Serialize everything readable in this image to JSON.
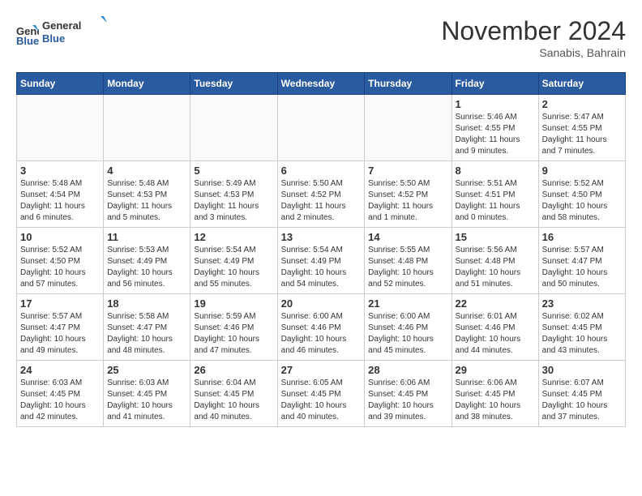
{
  "logo": {
    "line1": "General",
    "line2": "Blue"
  },
  "title": "November 2024",
  "location": "Sanabis, Bahrain",
  "weekdays": [
    "Sunday",
    "Monday",
    "Tuesday",
    "Wednesday",
    "Thursday",
    "Friday",
    "Saturday"
  ],
  "weeks": [
    [
      {
        "day": "",
        "info": ""
      },
      {
        "day": "",
        "info": ""
      },
      {
        "day": "",
        "info": ""
      },
      {
        "day": "",
        "info": ""
      },
      {
        "day": "",
        "info": ""
      },
      {
        "day": "1",
        "info": "Sunrise: 5:46 AM\nSunset: 4:55 PM\nDaylight: 11 hours and 9 minutes."
      },
      {
        "day": "2",
        "info": "Sunrise: 5:47 AM\nSunset: 4:55 PM\nDaylight: 11 hours and 7 minutes."
      }
    ],
    [
      {
        "day": "3",
        "info": "Sunrise: 5:48 AM\nSunset: 4:54 PM\nDaylight: 11 hours and 6 minutes."
      },
      {
        "day": "4",
        "info": "Sunrise: 5:48 AM\nSunset: 4:53 PM\nDaylight: 11 hours and 5 minutes."
      },
      {
        "day": "5",
        "info": "Sunrise: 5:49 AM\nSunset: 4:53 PM\nDaylight: 11 hours and 3 minutes."
      },
      {
        "day": "6",
        "info": "Sunrise: 5:50 AM\nSunset: 4:52 PM\nDaylight: 11 hours and 2 minutes."
      },
      {
        "day": "7",
        "info": "Sunrise: 5:50 AM\nSunset: 4:52 PM\nDaylight: 11 hours and 1 minute."
      },
      {
        "day": "8",
        "info": "Sunrise: 5:51 AM\nSunset: 4:51 PM\nDaylight: 11 hours and 0 minutes."
      },
      {
        "day": "9",
        "info": "Sunrise: 5:52 AM\nSunset: 4:50 PM\nDaylight: 10 hours and 58 minutes."
      }
    ],
    [
      {
        "day": "10",
        "info": "Sunrise: 5:52 AM\nSunset: 4:50 PM\nDaylight: 10 hours and 57 minutes."
      },
      {
        "day": "11",
        "info": "Sunrise: 5:53 AM\nSunset: 4:49 PM\nDaylight: 10 hours and 56 minutes."
      },
      {
        "day": "12",
        "info": "Sunrise: 5:54 AM\nSunset: 4:49 PM\nDaylight: 10 hours and 55 minutes."
      },
      {
        "day": "13",
        "info": "Sunrise: 5:54 AM\nSunset: 4:49 PM\nDaylight: 10 hours and 54 minutes."
      },
      {
        "day": "14",
        "info": "Sunrise: 5:55 AM\nSunset: 4:48 PM\nDaylight: 10 hours and 52 minutes."
      },
      {
        "day": "15",
        "info": "Sunrise: 5:56 AM\nSunset: 4:48 PM\nDaylight: 10 hours and 51 minutes."
      },
      {
        "day": "16",
        "info": "Sunrise: 5:57 AM\nSunset: 4:47 PM\nDaylight: 10 hours and 50 minutes."
      }
    ],
    [
      {
        "day": "17",
        "info": "Sunrise: 5:57 AM\nSunset: 4:47 PM\nDaylight: 10 hours and 49 minutes."
      },
      {
        "day": "18",
        "info": "Sunrise: 5:58 AM\nSunset: 4:47 PM\nDaylight: 10 hours and 48 minutes."
      },
      {
        "day": "19",
        "info": "Sunrise: 5:59 AM\nSunset: 4:46 PM\nDaylight: 10 hours and 47 minutes."
      },
      {
        "day": "20",
        "info": "Sunrise: 6:00 AM\nSunset: 4:46 PM\nDaylight: 10 hours and 46 minutes."
      },
      {
        "day": "21",
        "info": "Sunrise: 6:00 AM\nSunset: 4:46 PM\nDaylight: 10 hours and 45 minutes."
      },
      {
        "day": "22",
        "info": "Sunrise: 6:01 AM\nSunset: 4:46 PM\nDaylight: 10 hours and 44 minutes."
      },
      {
        "day": "23",
        "info": "Sunrise: 6:02 AM\nSunset: 4:45 PM\nDaylight: 10 hours and 43 minutes."
      }
    ],
    [
      {
        "day": "24",
        "info": "Sunrise: 6:03 AM\nSunset: 4:45 PM\nDaylight: 10 hours and 42 minutes."
      },
      {
        "day": "25",
        "info": "Sunrise: 6:03 AM\nSunset: 4:45 PM\nDaylight: 10 hours and 41 minutes."
      },
      {
        "day": "26",
        "info": "Sunrise: 6:04 AM\nSunset: 4:45 PM\nDaylight: 10 hours and 40 minutes."
      },
      {
        "day": "27",
        "info": "Sunrise: 6:05 AM\nSunset: 4:45 PM\nDaylight: 10 hours and 40 minutes."
      },
      {
        "day": "28",
        "info": "Sunrise: 6:06 AM\nSunset: 4:45 PM\nDaylight: 10 hours and 39 minutes."
      },
      {
        "day": "29",
        "info": "Sunrise: 6:06 AM\nSunset: 4:45 PM\nDaylight: 10 hours and 38 minutes."
      },
      {
        "day": "30",
        "info": "Sunrise: 6:07 AM\nSunset: 4:45 PM\nDaylight: 10 hours and 37 minutes."
      }
    ]
  ]
}
